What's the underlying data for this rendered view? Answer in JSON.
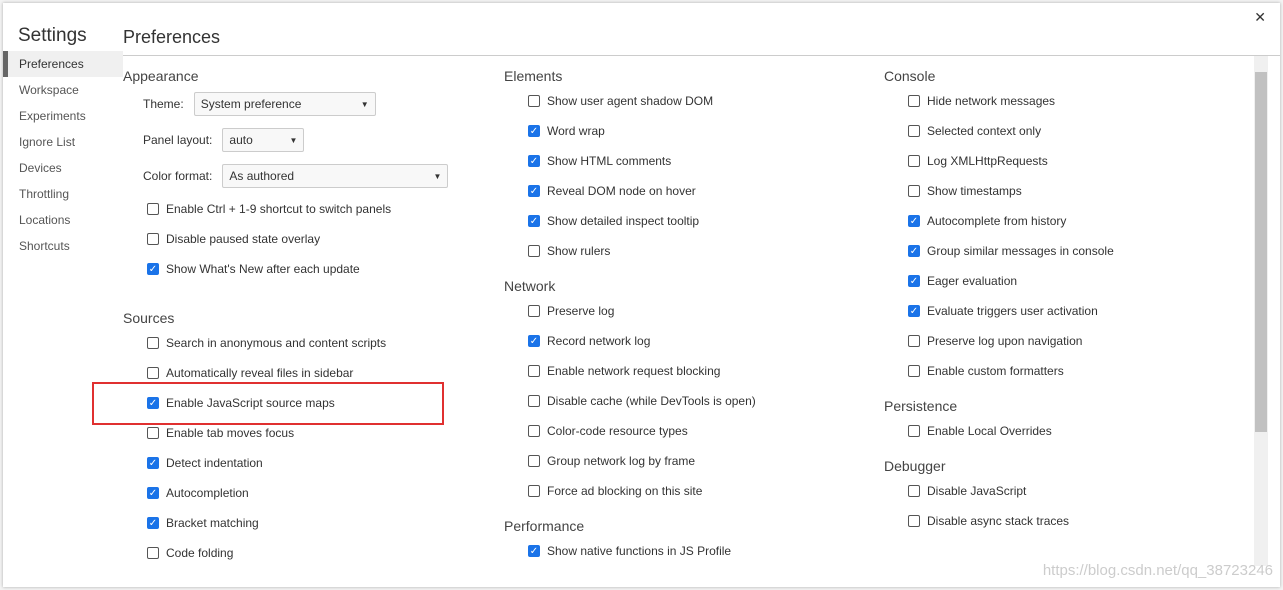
{
  "title": "Settings",
  "close_icon": "close-icon",
  "sidebar": [
    "Preferences",
    "Workspace",
    "Experiments",
    "Ignore List",
    "Devices",
    "Throttling",
    "Locations",
    "Shortcuts"
  ],
  "page_title": "Preferences",
  "appearance": {
    "title": "Appearance",
    "theme_label": "Theme:",
    "theme_value": "System preference",
    "panel_label": "Panel layout:",
    "panel_value": "auto",
    "color_label": "Color format:",
    "color_value": "As authored",
    "items": [
      {
        "label": "Enable Ctrl + 1-9 shortcut to switch panels",
        "checked": false
      },
      {
        "label": "Disable paused state overlay",
        "checked": false
      },
      {
        "label": "Show What's New after each update",
        "checked": true
      }
    ]
  },
  "sources": {
    "title": "Sources",
    "items": [
      {
        "label": "Search in anonymous and content scripts",
        "checked": false
      },
      {
        "label": "Automatically reveal files in sidebar",
        "checked": false
      },
      {
        "label": "Enable JavaScript source maps",
        "checked": true
      },
      {
        "label": "Enable tab moves focus",
        "checked": false
      },
      {
        "label": "Detect indentation",
        "checked": true
      },
      {
        "label": "Autocompletion",
        "checked": true
      },
      {
        "label": "Bracket matching",
        "checked": true
      },
      {
        "label": "Code folding",
        "checked": false
      }
    ]
  },
  "elements": {
    "title": "Elements",
    "items": [
      {
        "label": "Show user agent shadow DOM",
        "checked": false
      },
      {
        "label": "Word wrap",
        "checked": true
      },
      {
        "label": "Show HTML comments",
        "checked": true
      },
      {
        "label": "Reveal DOM node on hover",
        "checked": true
      },
      {
        "label": "Show detailed inspect tooltip",
        "checked": true
      },
      {
        "label": "Show rulers",
        "checked": false
      }
    ]
  },
  "network": {
    "title": "Network",
    "items": [
      {
        "label": "Preserve log",
        "checked": false
      },
      {
        "label": "Record network log",
        "checked": true
      },
      {
        "label": "Enable network request blocking",
        "checked": false
      },
      {
        "label": "Disable cache (while DevTools is open)",
        "checked": false
      },
      {
        "label": "Color-code resource types",
        "checked": false
      },
      {
        "label": "Group network log by frame",
        "checked": false
      },
      {
        "label": "Force ad blocking on this site",
        "checked": false
      }
    ]
  },
  "performance": {
    "title": "Performance",
    "items": [
      {
        "label": "Show native functions in JS Profile",
        "checked": true
      }
    ]
  },
  "console": {
    "title": "Console",
    "items": [
      {
        "label": "Hide network messages",
        "checked": false
      },
      {
        "label": "Selected context only",
        "checked": false
      },
      {
        "label": "Log XMLHttpRequests",
        "checked": false
      },
      {
        "label": "Show timestamps",
        "checked": false
      },
      {
        "label": "Autocomplete from history",
        "checked": true
      },
      {
        "label": "Group similar messages in console",
        "checked": true
      },
      {
        "label": "Eager evaluation",
        "checked": true
      },
      {
        "label": "Evaluate triggers user activation",
        "checked": true
      },
      {
        "label": "Preserve log upon navigation",
        "checked": false
      },
      {
        "label": "Enable custom formatters",
        "checked": false
      }
    ]
  },
  "persistence": {
    "title": "Persistence",
    "items": [
      {
        "label": "Enable Local Overrides",
        "checked": false
      }
    ]
  },
  "debugger": {
    "title": "Debugger",
    "items": [
      {
        "label": "Disable JavaScript",
        "checked": false
      },
      {
        "label": "Disable async stack traces",
        "checked": false
      }
    ]
  },
  "watermark": "https://blog.csdn.net/qq_38723246",
  "highlight_color": "#e03030",
  "accent": "#1a73e8"
}
